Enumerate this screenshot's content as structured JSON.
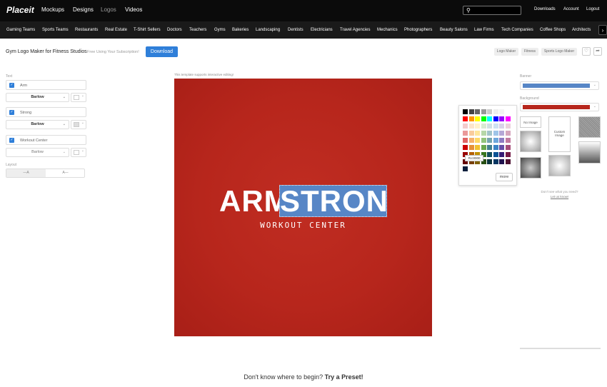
{
  "header": {
    "logo": "Placeit",
    "nav": [
      "Mockups",
      "Designs",
      "Logos",
      "Videos"
    ],
    "links": [
      "Downloads",
      "Account",
      "Logout"
    ]
  },
  "categories": [
    "Gaming Teams",
    "Sports Teams",
    "Restaurants",
    "Real Estate",
    "T-Shirt Sellers",
    "Doctors",
    "Teachers",
    "Gyms",
    "Bakeries",
    "Landscaping",
    "Dentists",
    "Electricians",
    "Travel Agencies",
    "Mechanics",
    "Photographers",
    "Beauty Salons",
    "Law Firms",
    "Tech Companies",
    "Coffee Shops",
    "Architects"
  ],
  "titlebar": {
    "title": "Gym Logo Maker for Fitness Studios",
    "subtitle": "Free Using Your Subscription!",
    "download": "Download",
    "tags": [
      "Logo Maker",
      "Fitness",
      "Sports Logo Maker"
    ]
  },
  "left": {
    "text_label": "Text",
    "fields": [
      {
        "value": "Arm",
        "font": "Barlow"
      },
      {
        "value": "Strong",
        "font": "Barlow"
      },
      {
        "value": "Workout Center",
        "font": "Barlow"
      }
    ],
    "layout_label": "Layout",
    "layout_options": [
      "—A",
      "A—"
    ]
  },
  "canvas": {
    "note": "This template supports interactive editing!",
    "word1": "ARM",
    "word2": "STRONG",
    "subline": "WORKOUT CENTER",
    "colors": {
      "bg": "#b7261c",
      "highlight": "#5786c6"
    }
  },
  "picker": {
    "tooltip": "#cc0000",
    "more": "more"
  },
  "right": {
    "banner_label": "Banner",
    "banner_color": "#5786c6",
    "background_label": "Background",
    "background_color": "#b7261c",
    "thumbs": [
      "No Image",
      "Custom Image"
    ],
    "help1": "Don't see what you need?",
    "help2": "Let us know!"
  },
  "footer": {
    "preset_question": "Don't know where to begin?",
    "preset_link": "Try a Preset!"
  }
}
